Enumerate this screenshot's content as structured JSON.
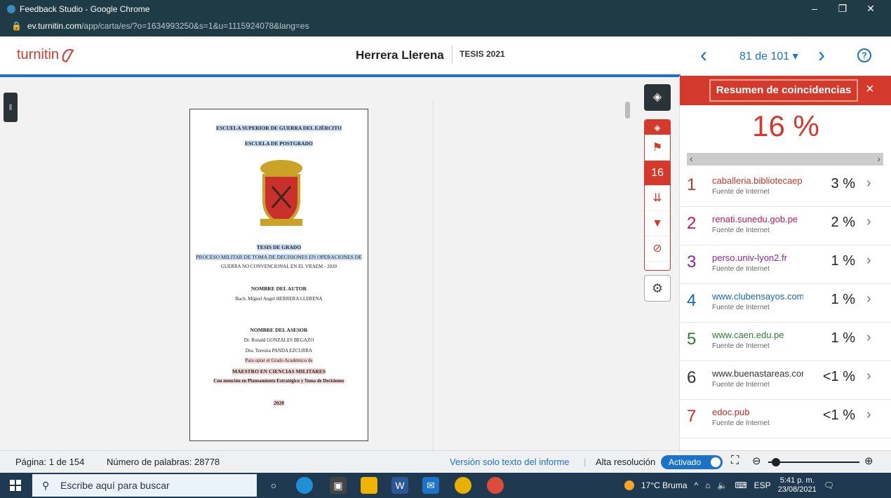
{
  "window": {
    "title": "Feedback Studio - Google Chrome",
    "url_domain": "ev.turnitin.com",
    "url_path": "/app/carta/es/?o=1634993250&s=1&u=1115924078&lang=es",
    "minimize_icon": "minimize-icon",
    "restore_icon": "restore-icon",
    "close_icon": "close-icon"
  },
  "header": {
    "logo_text": "turnitin",
    "doc_author": "Herrera Llerena",
    "doc_tag": "TESIS 2021",
    "page_counter": "81 de 101 ▾",
    "help_label": "?"
  },
  "document": {
    "lines": [
      "ESCUELA SUPERIOR DE GUERRA DEL EJÉRCITO",
      "ESCUELA DE POSTGRADO",
      "TESIS DE GRADO",
      "PROCESO MILITAR DE TOMA DE DECISIONES EN OPERACIONES DE",
      "GUERRA NO CONVENCIONAL EN EL VRAEM - 2020",
      "NOMBRE DEL AUTOR",
      "Bach. Miguel Angel HERRERA LLERENA",
      "NOMBRE DEL ASESOR",
      "Dr. Ronald GONZALES BEGAZO",
      "Dra. Teresita PANDA EZCURRA",
      "Para optar el Grado Académico de",
      "MAESTRO EN CIENCIAS MILITARES",
      "Con mención en Planeamiento Estratégico y Toma de Decisiones",
      "2020"
    ]
  },
  "toolbar": {
    "score_badge": "16"
  },
  "panel": {
    "title": "Resumen de coincidencias",
    "close": "×",
    "score": "16 %",
    "sources": [
      {
        "num": "1",
        "url": "caballeria.bibliotecaep....",
        "type": "Fuente de Internet",
        "pct": "3 %",
        "color": "#c0392b"
      },
      {
        "num": "2",
        "url": "renati.sunedu.gob.pe",
        "type": "Fuente de Internet",
        "pct": "2 %",
        "color": "#c2185b"
      },
      {
        "num": "3",
        "url": "perso.univ-lyon2.fr",
        "type": "Fuente de Internet",
        "pct": "1 %",
        "color": "#8e24aa"
      },
      {
        "num": "4",
        "url": "www.clubensayos.com",
        "type": "Fuente de Internet",
        "pct": "1 %",
        "color": "#1565c0"
      },
      {
        "num": "5",
        "url": "www.caen.edu.pe",
        "type": "Fuente de Internet",
        "pct": "1 %",
        "color": "#2e7d32"
      },
      {
        "num": "6",
        "url": "www.buenastareas.com",
        "type": "Fuente de Internet",
        "pct": "<1 %",
        "color": "#333333"
      },
      {
        "num": "7",
        "url": "edoc.pub",
        "type": "Fuente de Internet",
        "pct": "<1 %",
        "color": "#c62828"
      }
    ]
  },
  "status": {
    "page": "Página: 1 de 154",
    "words": "Número de palabras: 28778",
    "text_only": "Versión solo texto del informe",
    "high_res": "Alta resolución",
    "toggle": "Activado"
  },
  "taskbar": {
    "search_placeholder": "Escribe aquí para buscar",
    "weather": "17°C  Bruma",
    "lang": "ESP",
    "time": "5:41 p. m.",
    "date": "23/08/2021"
  }
}
